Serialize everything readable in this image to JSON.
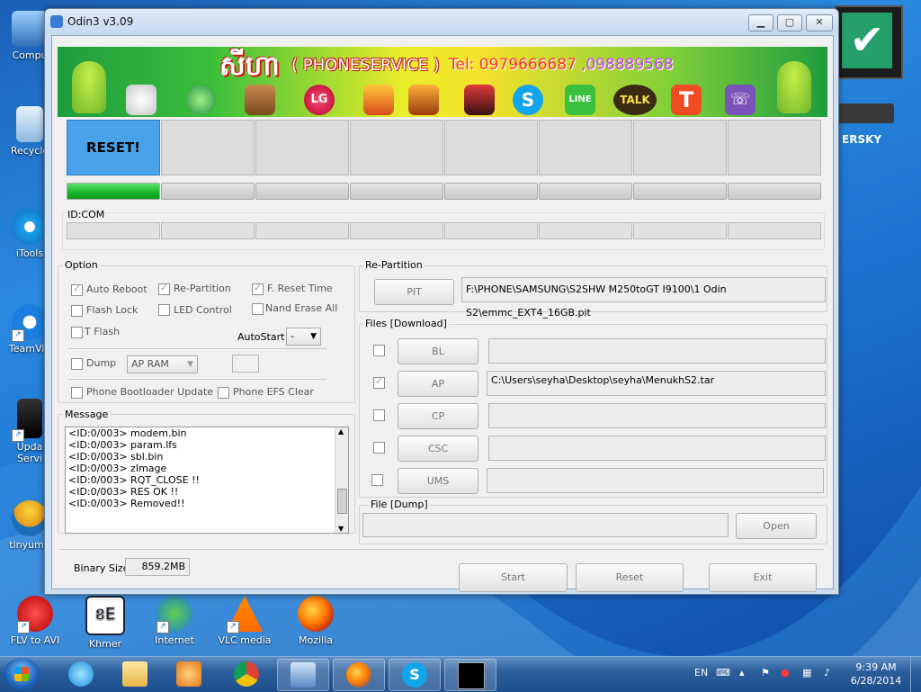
{
  "window": {
    "title": "Odin3 v3.09",
    "minimize": "▁",
    "maximize": "▢",
    "close": "✕"
  },
  "banner": {
    "logo_text": "សីហា",
    "service": "( PHONESERVICE )",
    "tel": "Tel: 0979666687",
    "tel_alt": ",098889568",
    "icons": [
      "apple-icon",
      "sony-ericsson-icon",
      "cydia-icon",
      "lg-icon",
      "subway-surfers-icon",
      "clash-of-clans-icon",
      "game-icon",
      "skype-icon",
      "line-icon",
      "kakaotalk-icon",
      "tango-icon",
      "viber-icon"
    ],
    "icon_labels": {
      "lg": "LG",
      "line": "LINE",
      "talk": "TALK",
      "tango": "T",
      "skype": "S"
    }
  },
  "status": {
    "reset_label": "RESET!",
    "id_com_label": "ID:COM",
    "progress": 1.0
  },
  "option": {
    "title": "Option",
    "auto_reboot": "Auto Reboot",
    "re_partition": "Re-Partition",
    "f_reset_time": "F. Reset Time",
    "flash_lock": "Flash Lock",
    "led_control": "LED Control",
    "nand_erase_all": "Nand Erase All",
    "t_flash": "T Flash",
    "autostart_label": "AutoStart",
    "autostart_value": "-",
    "dump": "Dump",
    "dump_select": "AP RAM",
    "phone_bootloader_update": "Phone Bootloader Update",
    "phone_efs_clear": "Phone EFS Clear"
  },
  "message": {
    "title": "Message",
    "lines": [
      "<ID:0/003> modem.bin",
      "<ID:0/003> param.lfs",
      "<ID:0/003> sbl.bin",
      "<ID:0/003> zImage",
      "<ID:0/003> RQT_CLOSE !!",
      "<ID:0/003> RES OK !!",
      "<ID:0/003> Removed!!"
    ]
  },
  "repartition": {
    "title": "Re-Partition",
    "pit_label": "PIT",
    "pit_path": "F:\\PHONE\\SAMSUNG\\S2SHW M250toGT I9100\\1 Odin S2\\emmc_EXT4_16GB.pit"
  },
  "files": {
    "title": "Files [Download]",
    "bl_label": "BL",
    "ap_label": "AP",
    "ap_path": "C:\\Users\\seyha\\Desktop\\seyha\\MenukhS2.tar",
    "cp_label": "CP",
    "csc_label": "CSC",
    "ums_label": "UMS"
  },
  "file_dump": {
    "title": "File [Dump]",
    "open_label": "Open"
  },
  "binary": {
    "label": "Binary Size",
    "value": "859.2MB"
  },
  "actions": {
    "start": "Start",
    "reset": "Reset",
    "exit": "Exit"
  },
  "desktop": {
    "computer": "Compu",
    "recycle": "Recycle",
    "itools": "iTools",
    "teamviewer": "TeamVie",
    "update_service_1": "Upda",
    "update_service_2": "Servi",
    "tinyumbrella": "tinyumb",
    "flv_to_avi": "FLV to AVI",
    "khmer": "Khmer",
    "internet": "Internet",
    "vlc": "VLC media",
    "mozilla": "Mozilla",
    "kaspersky": "ERSKY"
  },
  "taskbar": {
    "language": "EN",
    "time": "9:39 AM",
    "date": "6/28/2014"
  },
  "colors": {
    "reset_blue": "#4aa3e8",
    "progress_green": "#14b425",
    "desktop_blue": "#1d74d0"
  }
}
